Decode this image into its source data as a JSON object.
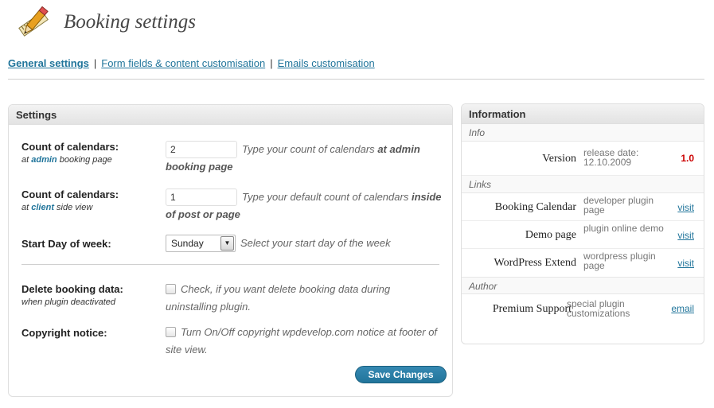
{
  "page": {
    "title": "Booking settings"
  },
  "tabs": [
    {
      "label": "General settings"
    },
    {
      "label": "Form fields & content customisation"
    },
    {
      "label": "Emails customisation"
    }
  ],
  "tab_separator": "|",
  "settings": {
    "heading": "Settings",
    "admin_calendars": {
      "label": "Count of calendars:",
      "sub_prefix": "at",
      "sub_highlight": "admin",
      "sub_suffix": "booking page",
      "value": "2",
      "hint": "Type your count of calendars",
      "hint_bold": "at admin booking page"
    },
    "client_calendars": {
      "label": "Count of calendars:",
      "sub_prefix": "at",
      "sub_highlight": "client",
      "sub_suffix": "side view",
      "value": "1",
      "hint": "Type your default count of calendars",
      "hint_bold": "inside of post or page"
    },
    "start_day": {
      "label": "Start Day of week:",
      "selected": "Sunday",
      "hint": "Select your start day of the week"
    },
    "delete_data": {
      "label": "Delete booking data:",
      "sub": "when plugin deactivated",
      "checked": false,
      "hint": "Check, if you want delete booking data during uninstalling plugin."
    },
    "copyright": {
      "label": "Copyright notice:",
      "checked": false,
      "hint": "Turn On/Off copyright wpdevelop.com notice at footer of site view."
    },
    "save_label": "Save Changes"
  },
  "information": {
    "heading": "Information",
    "info_section": "Info",
    "version": {
      "key": "Version",
      "value": "release date: 12.10.2009",
      "number": "1.0"
    },
    "links_section": "Links",
    "links": [
      {
        "key": "Booking Calendar",
        "value": "developer plugin page",
        "action": "visit"
      },
      {
        "key": "Demo page",
        "value": "plugin online demo",
        "action": "visit"
      },
      {
        "key": "WordPress Extend",
        "value": "wordpress plugin page",
        "action": "visit"
      }
    ],
    "author_section": "Author",
    "author": {
      "key": "Premium Support",
      "value": "special plugin customizations",
      "action": "email"
    }
  },
  "colors": {
    "link": "#21759b",
    "version": "#cc0000",
    "button": "#21759b"
  }
}
